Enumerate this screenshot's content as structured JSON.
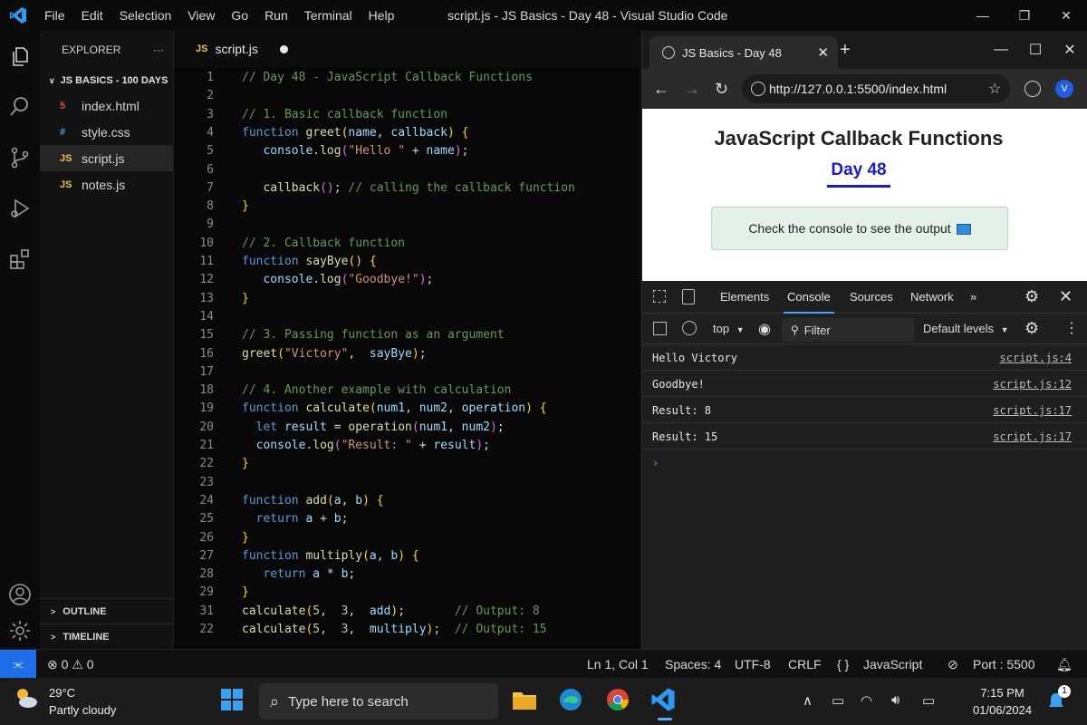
{
  "titlebar": {
    "menu": [
      "File",
      "Edit",
      "Selection",
      "View",
      "Go",
      "Run",
      "Terminal",
      "Help"
    ],
    "title": "script.js - JS Basics - Day 48 - Visual Studio Code"
  },
  "sidebar": {
    "header": "EXPLORER",
    "more": "···",
    "folder": "JS BASICS - 100 DAYS",
    "files": [
      {
        "icon": "5",
        "name": "index.html",
        "color": "#e44d26"
      },
      {
        "icon": "#",
        "name": "style.css",
        "color": "#42a5f5"
      },
      {
        "icon": "JS",
        "name": "script.js",
        "color": "#e8c544"
      },
      {
        "icon": "JS",
        "name": "notes.js",
        "color": "#e8c544"
      }
    ],
    "outline": "OUTLINE",
    "timeline": "TIMELINE"
  },
  "editor": {
    "tab_icon": "JS",
    "tab_label": "script.js",
    "lines": [
      {
        "n": "1",
        "tokens": [
          [
            "com",
            "// Day 48 - JavaScript Callback Functions"
          ]
        ]
      },
      {
        "n": "2",
        "tokens": []
      },
      {
        "n": "3",
        "tokens": [
          [
            "com",
            "// 1. Basic callback function"
          ]
        ]
      },
      {
        "n": "4",
        "tokens": [
          [
            "kw",
            "function "
          ],
          [
            "fn",
            "greet"
          ],
          [
            "br",
            "("
          ],
          [
            "var",
            "name"
          ],
          [
            "",
            ", "
          ],
          [
            "var",
            "callback"
          ],
          [
            "br",
            ")"
          ],
          [
            "",
            " "
          ],
          [
            "br",
            "{"
          ]
        ]
      },
      {
        "n": "5",
        "tokens": [
          [
            "",
            "   "
          ],
          [
            "var",
            "console"
          ],
          [
            "",
            "."
          ],
          [
            "fn",
            "log"
          ],
          [
            "br2",
            "("
          ],
          [
            "str",
            "\"Hello \""
          ],
          [
            "",
            " + "
          ],
          [
            "var",
            "name"
          ],
          [
            "br2",
            ")"
          ],
          [
            "",
            ";"
          ]
        ]
      },
      {
        "n": "6",
        "tokens": []
      },
      {
        "n": "7",
        "tokens": [
          [
            "",
            "   "
          ],
          [
            "fn",
            "callback"
          ],
          [
            "br2",
            "()"
          ],
          [
            "",
            "; "
          ],
          [
            "com",
            "// calling the callback function"
          ]
        ]
      },
      {
        "n": "8",
        "tokens": [
          [
            "br",
            "}"
          ]
        ]
      },
      {
        "n": "9",
        "tokens": []
      },
      {
        "n": "10",
        "tokens": [
          [
            "com",
            "// 2. Callback function"
          ]
        ]
      },
      {
        "n": "11",
        "tokens": [
          [
            "kw",
            "function "
          ],
          [
            "fn",
            "sayBye"
          ],
          [
            "br",
            "()"
          ],
          [
            "",
            " "
          ],
          [
            "br",
            "{"
          ]
        ]
      },
      {
        "n": "12",
        "tokens": [
          [
            "",
            "   "
          ],
          [
            "var",
            "console"
          ],
          [
            "",
            "."
          ],
          [
            "fn",
            "log"
          ],
          [
            "br2",
            "("
          ],
          [
            "str",
            "\"Goodbye!\""
          ],
          [
            "br2",
            ")"
          ],
          [
            "",
            ";"
          ]
        ]
      },
      {
        "n": "13",
        "tokens": [
          [
            "br",
            "}"
          ]
        ]
      },
      {
        "n": "14",
        "tokens": []
      },
      {
        "n": "15",
        "tokens": [
          [
            "com",
            "// 3. Passing function as an argument"
          ]
        ]
      },
      {
        "n": "16",
        "tokens": [
          [
            "fn",
            "greet"
          ],
          [
            "br",
            "("
          ],
          [
            "str",
            "\"Victory\""
          ],
          [
            "",
            ",  "
          ],
          [
            "var",
            "sayBye"
          ],
          [
            "br",
            ")"
          ],
          [
            "",
            ";"
          ]
        ]
      },
      {
        "n": "17",
        "tokens": []
      },
      {
        "n": "18",
        "tokens": [
          [
            "com",
            "// 4. Another example with calculation"
          ]
        ]
      },
      {
        "n": "19",
        "tokens": [
          [
            "kw",
            "function "
          ],
          [
            "fn",
            "calculate"
          ],
          [
            "br",
            "("
          ],
          [
            "var",
            "num1"
          ],
          [
            "",
            ", "
          ],
          [
            "var",
            "num2"
          ],
          [
            "",
            ", "
          ],
          [
            "var",
            "operation"
          ],
          [
            "br",
            ")"
          ],
          [
            "",
            " "
          ],
          [
            "br",
            "{"
          ]
        ]
      },
      {
        "n": "20",
        "tokens": [
          [
            "",
            "  "
          ],
          [
            "kw",
            "let "
          ],
          [
            "var",
            "result"
          ],
          [
            "",
            " = "
          ],
          [
            "fn",
            "operation"
          ],
          [
            "br2",
            "("
          ],
          [
            "var",
            "num1"
          ],
          [
            "",
            ", "
          ],
          [
            "var",
            "num2"
          ],
          [
            "br2",
            ")"
          ],
          [
            "",
            ";"
          ]
        ]
      },
      {
        "n": "21",
        "tokens": [
          [
            "",
            "  "
          ],
          [
            "var",
            "console"
          ],
          [
            "",
            "."
          ],
          [
            "fn",
            "log"
          ],
          [
            "br2",
            "("
          ],
          [
            "str",
            "\"Result: \""
          ],
          [
            "",
            " + "
          ],
          [
            "var",
            "result"
          ],
          [
            "br2",
            ")"
          ],
          [
            "",
            ";"
          ]
        ]
      },
      {
        "n": "22",
        "tokens": [
          [
            "br",
            "}"
          ]
        ]
      },
      {
        "n": "23",
        "tokens": []
      },
      {
        "n": "24",
        "tokens": [
          [
            "kw",
            "function "
          ],
          [
            "fn",
            "add"
          ],
          [
            "br",
            "("
          ],
          [
            "var",
            "a"
          ],
          [
            "",
            ", "
          ],
          [
            "var",
            "b"
          ],
          [
            "br",
            ")"
          ],
          [
            "",
            " "
          ],
          [
            "br",
            "{"
          ]
        ]
      },
      {
        "n": "25",
        "tokens": [
          [
            "",
            "  "
          ],
          [
            "kw",
            "return "
          ],
          [
            "var",
            "a"
          ],
          [
            "",
            " + "
          ],
          [
            "var",
            "b"
          ],
          [
            "",
            ";"
          ]
        ]
      },
      {
        "n": "26",
        "tokens": [
          [
            "br",
            "}"
          ]
        ]
      },
      {
        "n": "27",
        "tokens": [
          [
            "kw",
            "function "
          ],
          [
            "fn",
            "multiply"
          ],
          [
            "br",
            "("
          ],
          [
            "var",
            "a"
          ],
          [
            "",
            ", "
          ],
          [
            "var",
            "b"
          ],
          [
            "br",
            ")"
          ],
          [
            "",
            " "
          ],
          [
            "br",
            "{"
          ]
        ]
      },
      {
        "n": "28",
        "tokens": [
          [
            "",
            "   "
          ],
          [
            "kw",
            "return "
          ],
          [
            "var",
            "a"
          ],
          [
            "",
            " * "
          ],
          [
            "var",
            "b"
          ],
          [
            "",
            ";"
          ]
        ]
      },
      {
        "n": "29",
        "tokens": [
          [
            "br",
            "}"
          ]
        ]
      },
      {
        "n": "31",
        "tokens": [
          [
            "fn",
            "calculate"
          ],
          [
            "br",
            "("
          ],
          [
            "num",
            "5"
          ],
          [
            "",
            ",  "
          ],
          [
            "num",
            "3"
          ],
          [
            "",
            ",  "
          ],
          [
            "var",
            "add"
          ],
          [
            "br",
            ")"
          ],
          [
            "",
            ";       "
          ],
          [
            "com",
            "// Output: 8"
          ]
        ]
      },
      {
        "n": "22",
        "tokens": [
          [
            "fn",
            "calculate"
          ],
          [
            "br",
            "("
          ],
          [
            "num",
            "5"
          ],
          [
            "",
            ",  "
          ],
          [
            "num",
            "3"
          ],
          [
            "",
            ",  "
          ],
          [
            "var",
            "multiply"
          ],
          [
            "br",
            ")"
          ],
          [
            "",
            ";  "
          ],
          [
            "com",
            "// Output: 15"
          ]
        ]
      }
    ]
  },
  "browser": {
    "tab_title": "JS Basics - Day 48",
    "url": "http://127.0.0.1:5500/index.html",
    "avatar": "V",
    "page": {
      "heading": "JavaScript Callback Functions",
      "subheading": "Day 48",
      "notice": "Check the console to see the output"
    },
    "devtools": {
      "tabs": [
        "Elements",
        "Console",
        "Sources",
        "Network"
      ],
      "more": "»",
      "context": "top",
      "filter_placeholder": "Filter",
      "levels": "Default levels",
      "console": [
        {
          "msg": "Hello Victory",
          "src": "script.js:4"
        },
        {
          "msg": "Goodbye!",
          "src": "script.js:12"
        },
        {
          "msg": "Result: 8",
          "src": "script.js:17"
        },
        {
          "msg": "Result: 15",
          "src": "script.js:17"
        }
      ],
      "prompt": "›"
    }
  },
  "statusbar": {
    "problems": "⊗ 0 ⚠ 0",
    "position": "Ln 1, Col 1",
    "spaces": "Spaces: 4",
    "encoding": "UTF-8",
    "eol": "CRLF",
    "language_icon": "{ }",
    "language": "JavaScript",
    "port": "Port : 5500"
  },
  "taskbar": {
    "temp": "29°C",
    "weather": "Partly cloudy",
    "search_placeholder": "Type here to search",
    "time": "7:15 PM",
    "date": "01/06/2024",
    "notif_count": "1"
  }
}
